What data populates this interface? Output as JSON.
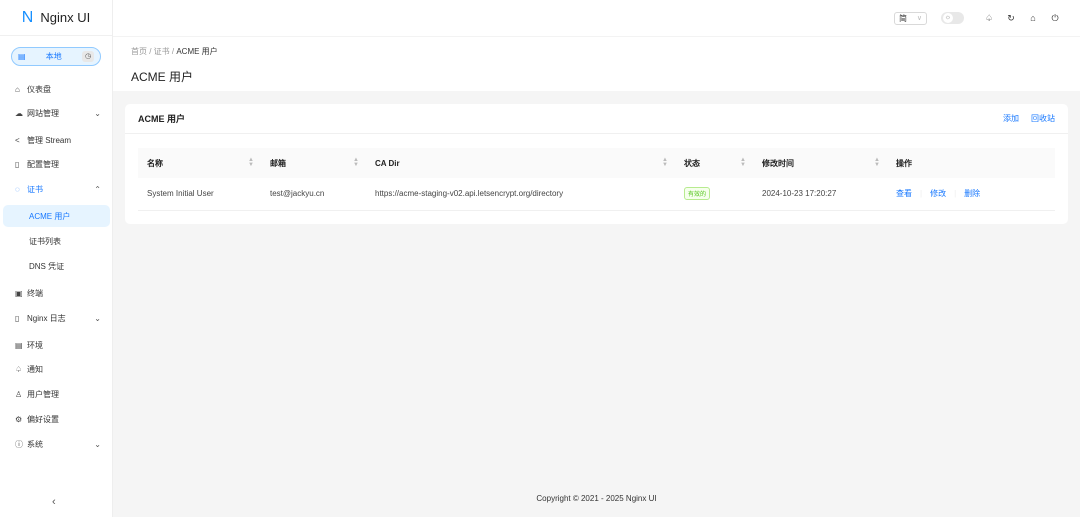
{
  "app": {
    "logo_letter": "N",
    "title": "Nginx UI"
  },
  "env": {
    "label": "本地"
  },
  "sidebar": {
    "items": [
      {
        "label": "仪表盘",
        "icon": "home-icon"
      },
      {
        "label": "网站管理",
        "icon": "cloud-icon"
      },
      {
        "label": "管理 Stream",
        "icon": "share-icon"
      },
      {
        "label": "配置管理",
        "icon": "file-icon"
      },
      {
        "label": "证书",
        "icon": "shield-icon"
      },
      {
        "label": "ACME 用户"
      },
      {
        "label": "证书列表"
      },
      {
        "label": "DNS 凭证"
      },
      {
        "label": "终端",
        "icon": "terminal-icon"
      },
      {
        "label": "Nginx 日志",
        "icon": "file-text-icon"
      },
      {
        "label": "环境",
        "icon": "database-icon"
      },
      {
        "label": "通知",
        "icon": "bell-icon"
      },
      {
        "label": "用户管理",
        "icon": "user-icon"
      },
      {
        "label": "偏好设置",
        "icon": "gear-icon"
      },
      {
        "label": "系统",
        "icon": "info-icon"
      }
    ]
  },
  "header": {
    "lang": "简"
  },
  "breadcrumb": [
    "首页",
    "证书",
    "ACME 用户"
  ],
  "page_title": "ACME 用户",
  "card": {
    "title": "ACME 用户",
    "add": "添加",
    "recycle": "回收站"
  },
  "table": {
    "columns": [
      "名称",
      "邮箱",
      "CA Dir",
      "状态",
      "修改时间",
      "操作"
    ],
    "rows": [
      {
        "name": "System Initial User",
        "email": "test@jackyu.cn",
        "ca_dir": "https://acme-staging-v02.api.letsencrypt.org/directory",
        "status": "有效的",
        "updated": "2024-10-23 17:20:27",
        "actions": [
          "查看",
          "修改",
          "删除"
        ]
      }
    ]
  },
  "footer": "Copyright © 2021 - 2025 Nginx UI",
  "colors": {
    "accent": "#1677ff",
    "success": "#52c41a"
  }
}
